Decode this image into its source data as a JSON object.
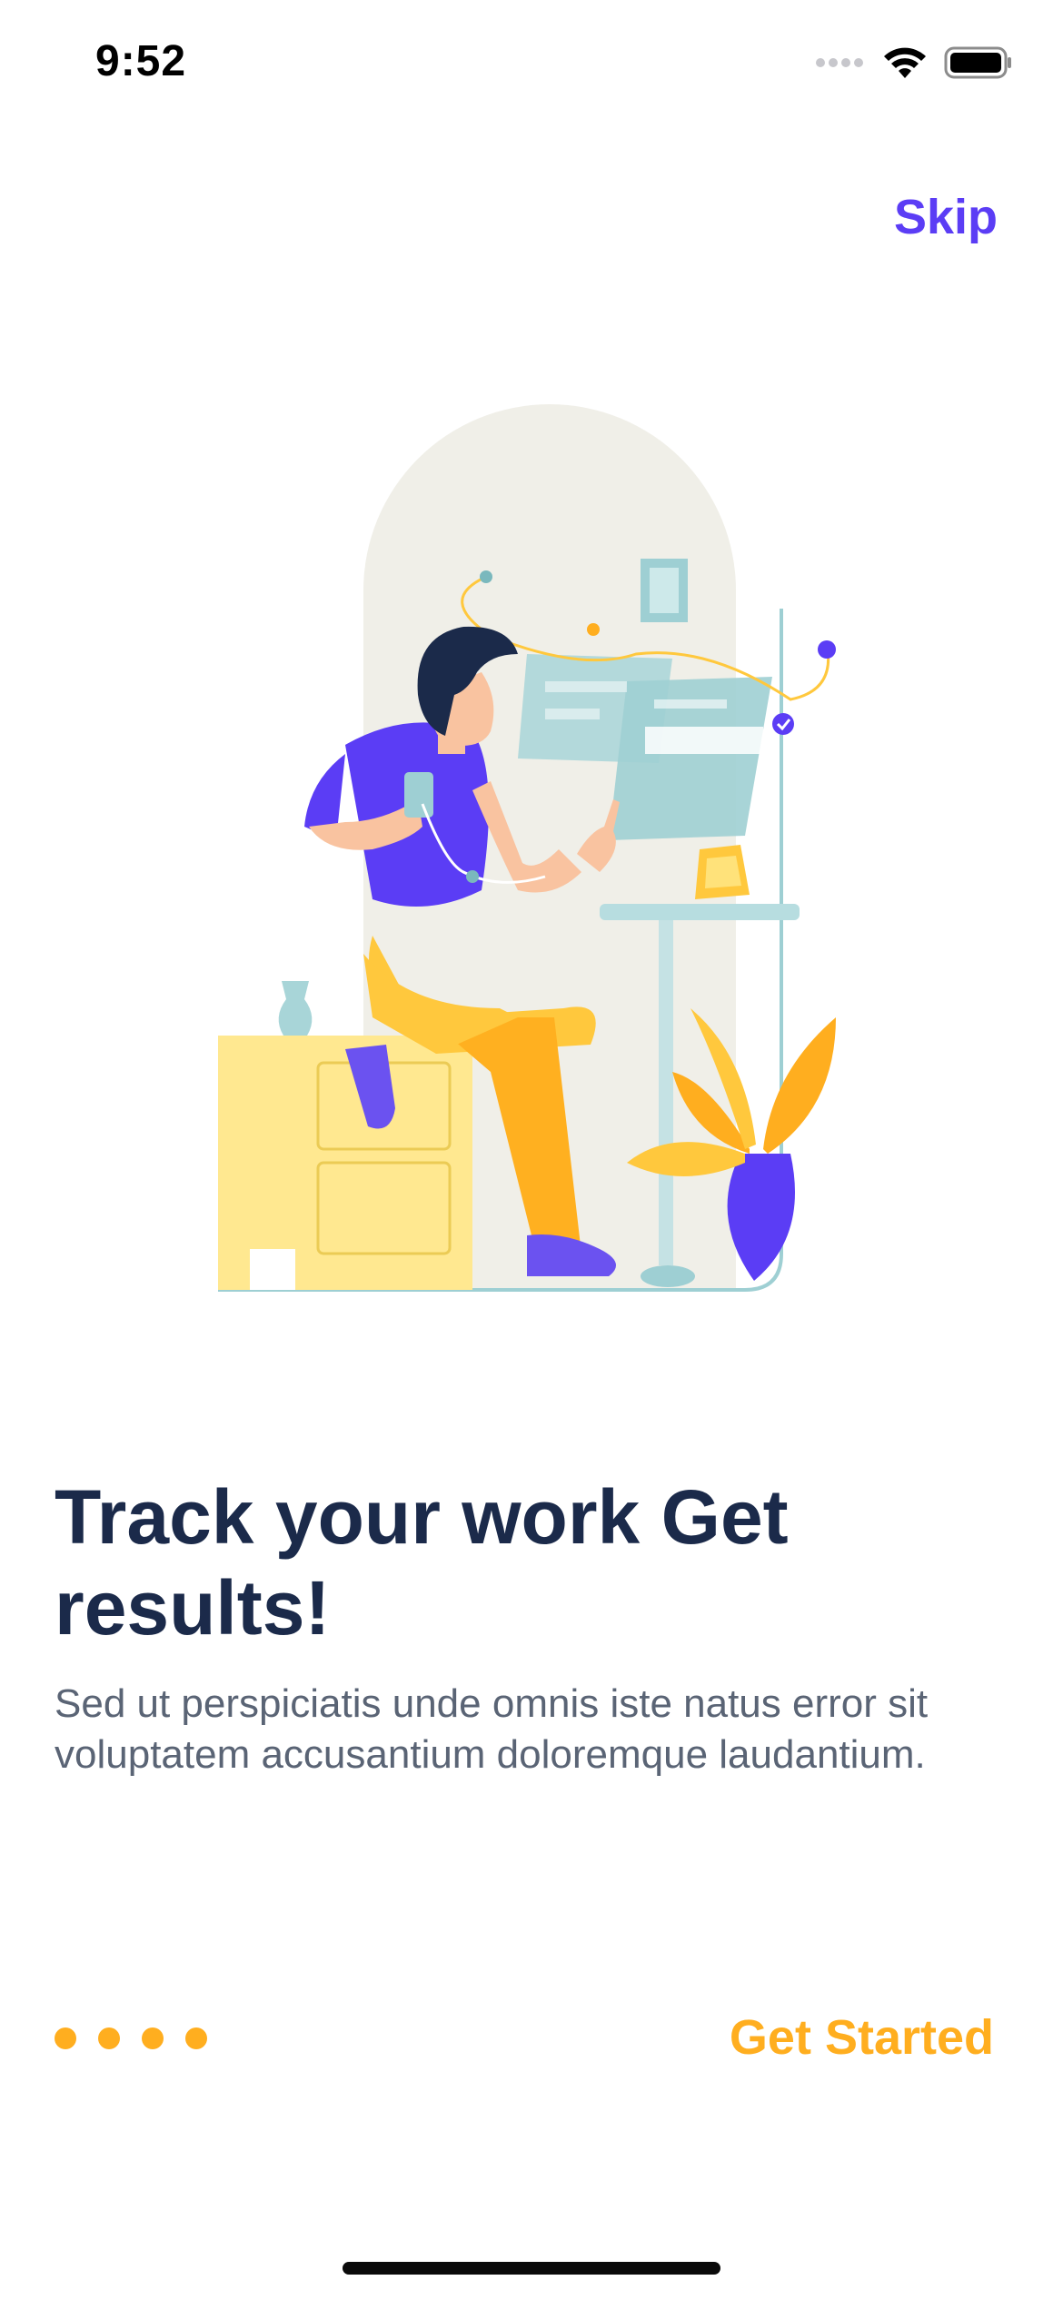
{
  "status_bar": {
    "time": "9:52",
    "icons": [
      "signal-icon",
      "wifi-icon",
      "battery-icon"
    ]
  },
  "header": {
    "skip_label": "Skip"
  },
  "onboarding": {
    "title": "Track your work Get results!",
    "description": "Sed ut perspiciatis unde omnis iste natus error sit voluptatem accusantium doloremque laudantium.",
    "illustration": "person-working-illustration"
  },
  "footer": {
    "page_dots": 4,
    "get_started_label": "Get Started"
  },
  "colors": {
    "accent_purple": "#5B3DF5",
    "accent_orange": "#FFAE1F",
    "title_navy": "#1B2A4A",
    "body_gray": "#5A6475"
  }
}
